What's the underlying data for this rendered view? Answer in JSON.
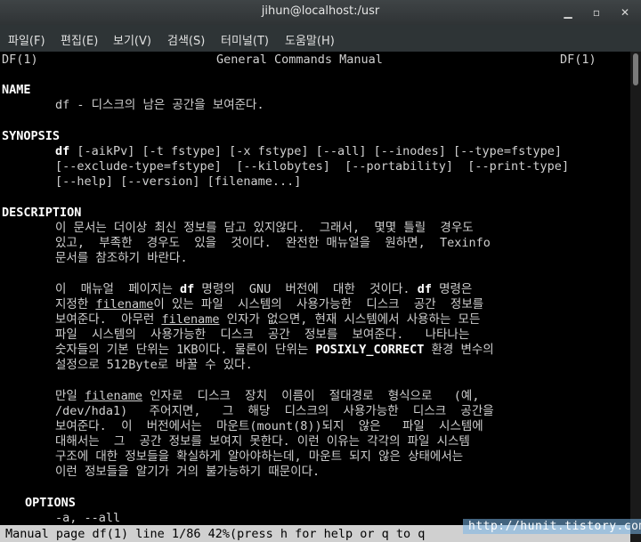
{
  "window": {
    "title": "jihun@localhost:/usr",
    "min_glyph": "▁",
    "max_glyph": "▫",
    "close_glyph": "✕"
  },
  "menu": {
    "items": [
      {
        "label": "파일(F)"
      },
      {
        "label": "편집(E)"
      },
      {
        "label": "보기(V)"
      },
      {
        "label": "검색(S)"
      },
      {
        "label": "터미널(T)"
      },
      {
        "label": "도움말(H)"
      }
    ]
  },
  "man": {
    "header_left": "DF(1)",
    "header_center": "General Commands Manual",
    "header_right": "DF(1)",
    "name_heading": "NAME",
    "name_text": "df - 디스크의 남은 공간을 보여준다.",
    "synopsis_heading": "SYNOPSIS",
    "synopsis_cmd": "df",
    "synopsis_line1": " [-aikPv] [-t fstype] [-x fstype] [--all] [--inodes] [--type=fstype]",
    "synopsis_line2": "[--exclude-type=fstype]  [--kilobytes]  [--portability]  [--print-type]",
    "synopsis_line3": "[--help] [--version] [filename...]",
    "description_heading": "DESCRIPTION",
    "desc_p1_l1": "이 문서는 더이상 최신 정보를 담고 있지않다.  그래서,  몇몇 틀릴  경우도",
    "desc_p1_l2": "있고,  부족한  경우도  있을  것이다.  완전한 매뉴얼을  원하면,  Texinfo",
    "desc_p1_l3": "문서를 참조하기 바란다.",
    "desc_p2_l1_a": "이  매뉴얼  페이지는 ",
    "desc_p2_l1_b": "df",
    "desc_p2_l1_c": " 명령의  GNU  버전에  대한  것이다. ",
    "desc_p2_l1_d": "df",
    "desc_p2_l1_e": " 명령은",
    "desc_p2_l2_a": "지정한 ",
    "desc_p2_l2_b": "filename",
    "desc_p2_l2_c": "이 있는 파일  시스템의  사용가능한  디스크  공간  정보를",
    "desc_p2_l3_a": "보여준다.  아무런 ",
    "desc_p2_l3_b": "filename",
    "desc_p2_l3_c": " 인자가 없으면, 현재 시스템에서 사용하는 모든",
    "desc_p2_l4": "파일  시스템의  사용가능한  디스크  공간  정보를  보여준다.   나타나는",
    "desc_p2_l5": "숫자들의 기본 단위는 1KB이다. 물론이 단위는 ",
    "desc_p2_l5_b": "POSIXLY_CORRECT",
    "desc_p2_l5_c": " 환경 변수의",
    "desc_p2_l6": "설정으로 512Byte로 바꿀 수 있다.",
    "desc_p3_l1_a": "만일 ",
    "desc_p3_l1_b": "filename",
    "desc_p3_l1_c": " 인자로  디스크  장치  이름이  절대경로  형식으로   (예,",
    "desc_p3_l2": "/dev/hda1)   주어지면,   그  해당  디스크의  사용가능한  디스크  공간을",
    "desc_p3_l3": "보여준다.  이  버전에서는  마운트(mount(8))되지  않은   파일  시스템에",
    "desc_p3_l4": "대해서는  그  공간 정보를 보여지 못한다. 이런 이유는 각각의 파일 시스템",
    "desc_p3_l5": "구조에 대한 정보들을 확실하게 알아야하는데, 마운트 되지 않은 상태에서는",
    "desc_p3_l6": "이런 정보들을 알기가 거의 불가능하기 때문이다.",
    "options_heading": "OPTIONS",
    "options_line1": "-a, --all"
  },
  "status": {
    "text": "Manual page df(1) line 1/86 42%(press h for help or q to q",
    "watermark": "http://hunit.tistory.com"
  },
  "scroll": {
    "position": 0.0,
    "visible_fraction": 0.42
  }
}
